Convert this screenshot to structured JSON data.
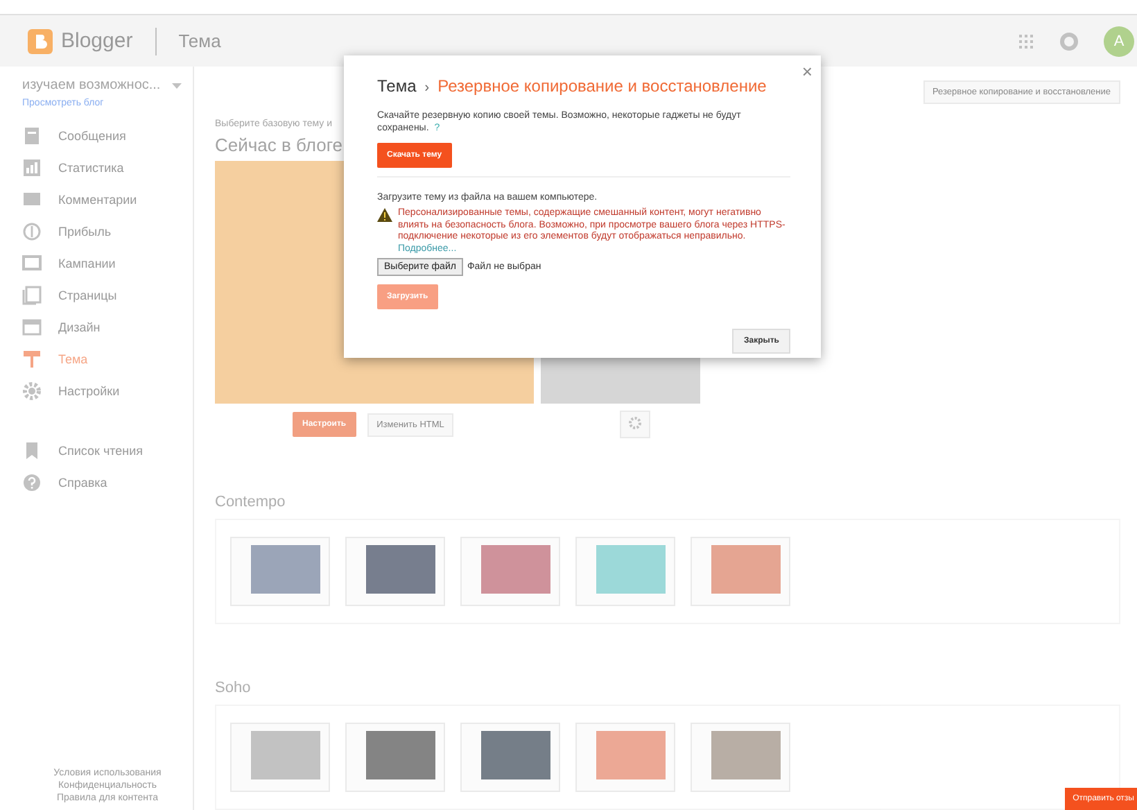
{
  "header": {
    "logo_text": "Blogger",
    "section": "Тема",
    "avatar_letter": "A"
  },
  "sidebar": {
    "blog_name": "изучаем возможнос...",
    "view_link": "Просмотреть блог",
    "items": [
      {
        "label": "Сообщения",
        "selected": false
      },
      {
        "label": "Статистика",
        "selected": false
      },
      {
        "label": "Комментарии",
        "selected": false
      },
      {
        "label": "Прибыль",
        "selected": false
      },
      {
        "label": "Кампании",
        "selected": false
      },
      {
        "label": "Страницы",
        "selected": false
      },
      {
        "label": "Дизайн",
        "selected": false
      },
      {
        "label": "Тема",
        "selected": true
      },
      {
        "label": "Настройки",
        "selected": false
      }
    ],
    "extra_items": [
      {
        "label": "Список чтения"
      },
      {
        "label": "Справка"
      }
    ],
    "footer_links": [
      "Условия использования",
      "Конфиденциальность",
      "Правила для контента"
    ]
  },
  "main": {
    "backup_button": "Резервное копирование и восстановление",
    "hint": "Выберите базовую тему и",
    "current_title": "Сейчас в блоге",
    "customize_button": "Настроить",
    "edit_html_button": "Изменить HTML",
    "theme_groups": [
      {
        "name": "Contempo"
      },
      {
        "name": "Soho"
      }
    ]
  },
  "dialog": {
    "crumb": "Тема",
    "separator": "›",
    "title": "Резервное копирование и восстановление",
    "download_text": "Скачайте резервную копию своей темы. Возможно, некоторые гаджеты не будут сохранены.",
    "help_mark": "?",
    "download_button": "Скачать тему",
    "upload_text": "Загрузите тему из файла на вашем компьютере.",
    "warning": "Персонализированные темы, содержащие смешанный контент, могут негативно влиять на безопасность блога. Возможно, при просмотре вашего блога через HTTPS-подключение некоторые из его элементов будут отображаться неправильно.",
    "warning_link": "Подробнее...",
    "file_button": "Выберите файл",
    "file_status": "Файл не выбран",
    "upload_button": {
      "label": "Загрузить",
      "disabled": true
    },
    "close_button": "Закрыть",
    "close_mark": "×"
  },
  "feedback_button": "Отправить отзы"
}
